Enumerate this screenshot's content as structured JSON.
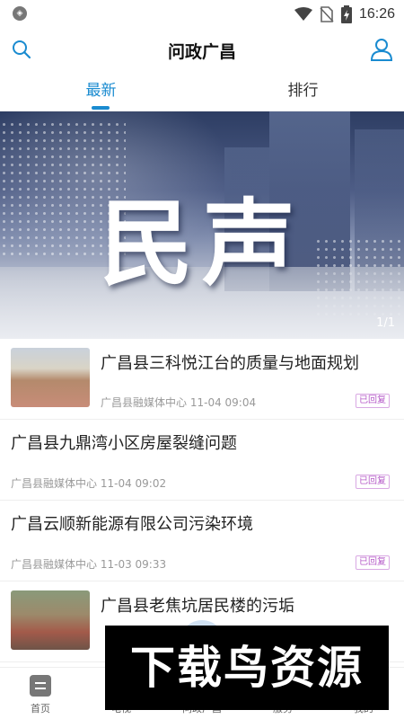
{
  "status_bar": {
    "time": "16:26"
  },
  "header": {
    "title": "问政广昌"
  },
  "tabs": [
    {
      "label": "最新",
      "active": true
    },
    {
      "label": "排行",
      "active": false
    }
  ],
  "banner": {
    "text": "民声",
    "pager": "1/1"
  },
  "news": [
    {
      "title": "广昌县三科悦江台的质量与地面规划",
      "source": "广昌县融媒体中心",
      "time": "11-04 09:04",
      "badge": "已回复"
    },
    {
      "title": "广昌县九鼎湾小区房屋裂缝问题",
      "source": "广昌县融媒体中心",
      "time": "11-04 09:02",
      "badge": "已回复"
    },
    {
      "title": "广昌云顺新能源有限公司污染环境",
      "source": "广昌县融媒体中心",
      "time": "11-03 09:33",
      "badge": "已回复"
    },
    {
      "title": "广昌县老焦坑居民楼的污垢",
      "source": "",
      "time": "",
      "badge": ""
    }
  ],
  "bottom_nav": [
    {
      "label": "首页"
    },
    {
      "label": "电视"
    },
    {
      "label": "问政广昌"
    },
    {
      "label": "服务"
    },
    {
      "label": "我的"
    }
  ],
  "watermark": {
    "text": "下载鸟资源"
  },
  "colors": {
    "accent": "#1a8bd0",
    "badge": "#b55bc8"
  }
}
